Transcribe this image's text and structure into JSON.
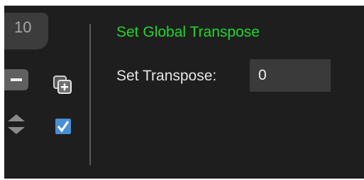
{
  "step": {
    "number": "10",
    "enabled": true
  },
  "panel": {
    "title": "Set Global Transpose",
    "title_color": "#22d52e",
    "transpose_label": "Set Transpose:",
    "transpose_value": "0"
  },
  "controls": {
    "remove_icon": "minus-icon",
    "duplicate_icon": "duplicate-plus-icon",
    "reorder_icon": "reorder-arrows-icon",
    "enabled_icon": "checkmark-icon",
    "checkbox_color": "#4a8fd4"
  }
}
